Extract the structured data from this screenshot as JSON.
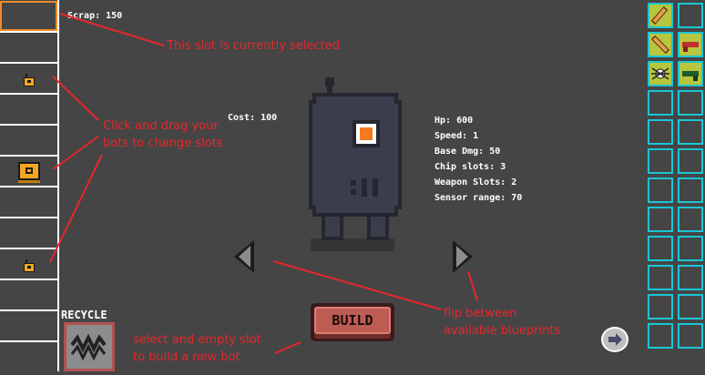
{
  "hud": {
    "scrap_label": "Scrap: 150",
    "cost_label": "Cost: 100"
  },
  "stats": [
    "Hp: 600",
    "Speed: 1",
    "Base Dmg: 50",
    "Chip slots: 3",
    "Weapon Slots: 2",
    "Sensor range: 70"
  ],
  "buttons": {
    "build": "BUILD",
    "recycle": "RECYCLE"
  },
  "annotations": {
    "selected": "This slot is currently selected",
    "drag_line1": "Click and drag your",
    "drag_line2": "bots to change slots",
    "flip_line1": "flip between",
    "flip_line2": "available blueprints",
    "empty_line1": "select and empty slot",
    "empty_line2": "to build a new bot"
  },
  "slots": [
    {
      "occupied": false,
      "selected": true
    },
    {
      "occupied": false
    },
    {
      "occupied": true,
      "bot": "small-bot-icon"
    },
    {
      "occupied": false
    },
    {
      "occupied": false
    },
    {
      "occupied": true,
      "bot": "large-bot-icon"
    },
    {
      "occupied": false
    },
    {
      "occupied": false
    },
    {
      "occupied": true,
      "bot": "small-bot-icon"
    },
    {
      "occupied": false
    },
    {
      "occupied": false
    },
    {
      "occupied": false
    }
  ],
  "inventory_items": [
    "bat-icon",
    "",
    "bat-icon",
    "red-gun-icon",
    "spider-chip-icon",
    "green-gun-icon"
  ],
  "colors": {
    "background": "#454545",
    "selected_slot": "#f08a2c",
    "inventory_border": "#19c6d6",
    "inventory_filled": "#b7c63e",
    "annotation": "#e8262c",
    "bot_body": "#353847",
    "bot_eye": "#f47a1f",
    "bot_icon": "#f5a623"
  }
}
